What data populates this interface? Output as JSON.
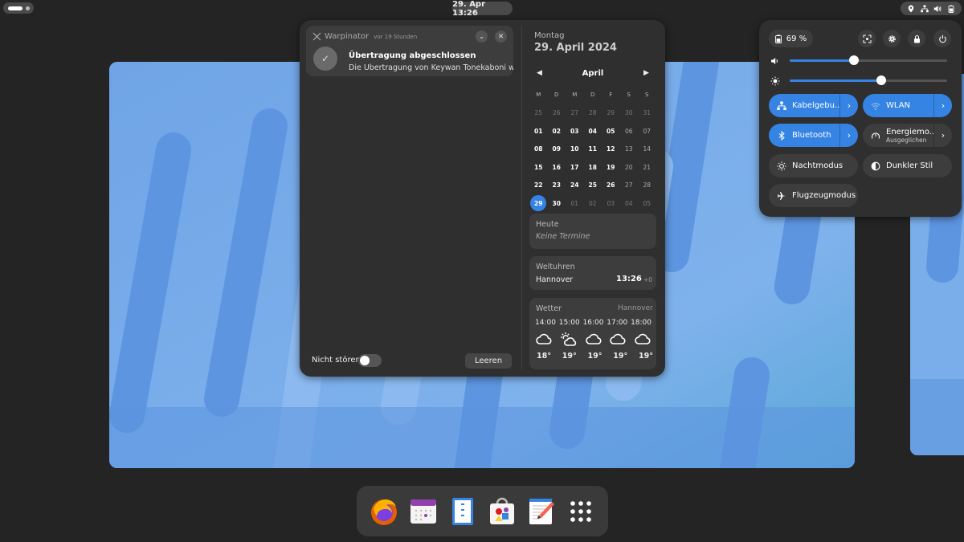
{
  "topbar": {
    "clock": "29. Apr  13:26",
    "indicators": [
      "location-icon",
      "network-wired-icon",
      "volume-icon",
      "battery-icon"
    ]
  },
  "notification": {
    "app": "Warpinator",
    "time": "vor 19 Stunden",
    "title": "Übertragung abgeschlossen",
    "body": "Die Übertragung von Keywan Tonekaboni wurd..."
  },
  "message_footer": {
    "dnd_label": "Nicht stören",
    "dnd_on": false,
    "clear_label": "Leeren"
  },
  "calendar": {
    "weekday": "Montag",
    "date": "29. April 2024",
    "month": "April",
    "headers": [
      "M",
      "D",
      "M",
      "D",
      "F",
      "S",
      "S"
    ],
    "weeks": [
      [
        "25",
        "26",
        "27",
        "28",
        "29",
        "30",
        "31"
      ],
      [
        "01",
        "02",
        "03",
        "04",
        "05",
        "06",
        "07"
      ],
      [
        "08",
        "09",
        "10",
        "11",
        "12",
        "13",
        "14"
      ],
      [
        "15",
        "16",
        "17",
        "18",
        "19",
        "20",
        "21"
      ],
      [
        "22",
        "23",
        "24",
        "25",
        "26",
        "27",
        "28"
      ],
      [
        "29",
        "30",
        "01",
        "02",
        "03",
        "04",
        "05"
      ]
    ],
    "today": "29"
  },
  "events": {
    "title": "Heute",
    "empty": "Keine Termine"
  },
  "world_clocks": {
    "title": "Weltuhren",
    "city": "Hannover",
    "time": "13:26",
    "offset": "+0"
  },
  "weather": {
    "title": "Wetter",
    "location": "Hannover",
    "hours": [
      "14:00",
      "15:00",
      "16:00",
      "17:00",
      "18:00"
    ],
    "icons": [
      "cloud",
      "partly-cloudy",
      "cloud",
      "cloud",
      "cloud"
    ],
    "temps": [
      "18°",
      "19°",
      "19°",
      "19°",
      "19°"
    ]
  },
  "quick_settings": {
    "battery": "69 %",
    "volume_level": 0.41,
    "brightness_level": 0.58,
    "tiles": {
      "wired": {
        "label": "Kabelgebu...",
        "on": true
      },
      "wlan": {
        "label": "WLAN",
        "on": true
      },
      "bluetooth": {
        "label": "Bluetooth",
        "on": true
      },
      "power": {
        "label": "Energiemo...",
        "sub": "Ausgeglichen",
        "on": false
      },
      "night": {
        "label": "Nachtmodus",
        "on": false
      },
      "dark": {
        "label": "Dunkler Stil",
        "on": false
      },
      "airplane": {
        "label": "Flugzeugmodus",
        "on": false
      }
    }
  },
  "dock": [
    "firefox",
    "calendar",
    "files",
    "software",
    "text-editor",
    "app-grid"
  ],
  "colors": {
    "accent": "#3584e4",
    "panel": "#2f2f2f",
    "card": "#3d3d3d",
    "wallpaper": "#79aae8"
  }
}
